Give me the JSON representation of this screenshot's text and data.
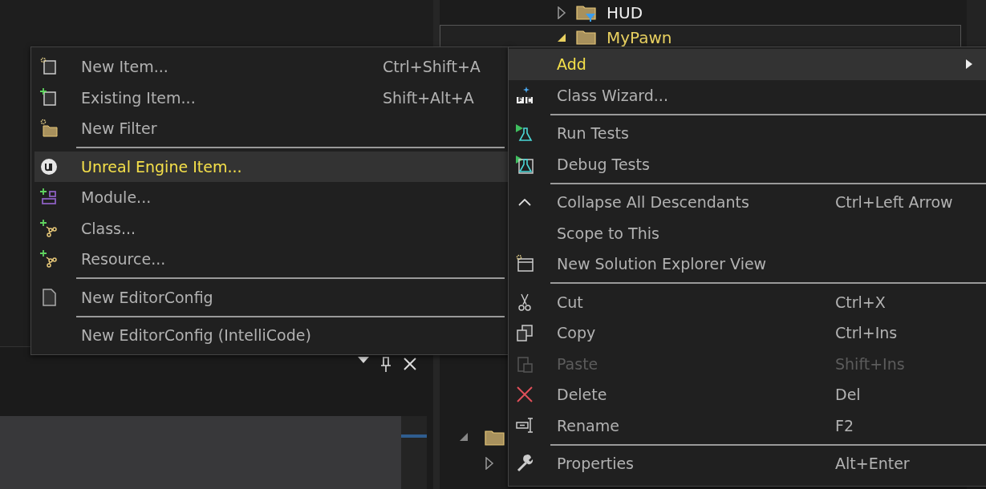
{
  "solution_tree": [
    {
      "label": "HUD",
      "expanded": false,
      "selected": false,
      "kind": "filter"
    },
    {
      "label": "MyPawn",
      "expanded": true,
      "selected": true,
      "kind": "folder"
    }
  ],
  "add_submenu": {
    "items": [
      {
        "kind": "item",
        "label": "New Item...",
        "shortcut": "Ctrl+Shift+A",
        "selected": false,
        "disabled": false
      },
      {
        "kind": "item",
        "label": "Existing Item...",
        "shortcut": "Shift+Alt+A",
        "selected": false,
        "disabled": false
      },
      {
        "kind": "item",
        "label": "New Filter",
        "selected": false,
        "disabled": false
      },
      {
        "kind": "separator"
      },
      {
        "kind": "item",
        "label": "Unreal Engine Item...",
        "selected": true,
        "disabled": false
      },
      {
        "kind": "item",
        "label": "Module...",
        "selected": false,
        "disabled": false
      },
      {
        "kind": "item",
        "label": "Class...",
        "selected": false,
        "disabled": false
      },
      {
        "kind": "item",
        "label": "Resource...",
        "selected": false,
        "disabled": false
      },
      {
        "kind": "separator"
      },
      {
        "kind": "item",
        "label": "New EditorConfig",
        "selected": false,
        "disabled": false
      },
      {
        "kind": "separator"
      },
      {
        "kind": "item",
        "label": "New EditorConfig (IntelliCode)",
        "selected": false,
        "disabled": false
      }
    ]
  },
  "context_menu": {
    "items": [
      {
        "kind": "submenu",
        "label": "Add",
        "selected": true,
        "disabled": false
      },
      {
        "kind": "item",
        "label": "Class Wizard...",
        "selected": false,
        "disabled": false
      },
      {
        "kind": "separator"
      },
      {
        "kind": "item",
        "label": "Run Tests",
        "selected": false,
        "disabled": false
      },
      {
        "kind": "item",
        "label": "Debug Tests",
        "selected": false,
        "disabled": false
      },
      {
        "kind": "separator"
      },
      {
        "kind": "item",
        "label": "Collapse All Descendants",
        "shortcut": "Ctrl+Left Arrow",
        "selected": false,
        "disabled": false
      },
      {
        "kind": "item",
        "label": "Scope to This",
        "selected": false,
        "disabled": false
      },
      {
        "kind": "item",
        "label": "New Solution Explorer View",
        "selected": false,
        "disabled": false
      },
      {
        "kind": "separator"
      },
      {
        "kind": "item",
        "label": "Cut",
        "shortcut": "Ctrl+X",
        "selected": false,
        "disabled": false
      },
      {
        "kind": "item",
        "label": "Copy",
        "shortcut": "Ctrl+Ins",
        "selected": false,
        "disabled": false
      },
      {
        "kind": "item",
        "label": "Paste",
        "shortcut": "Shift+Ins",
        "selected": false,
        "disabled": true
      },
      {
        "kind": "item",
        "label": "Delete",
        "shortcut": "Del",
        "selected": false,
        "disabled": false
      },
      {
        "kind": "item",
        "label": "Rename",
        "shortcut": "F2",
        "selected": false,
        "disabled": false
      },
      {
        "kind": "separator"
      },
      {
        "kind": "item",
        "label": "Properties",
        "shortcut": "Alt+Enter",
        "selected": false,
        "disabled": false
      }
    ]
  }
}
